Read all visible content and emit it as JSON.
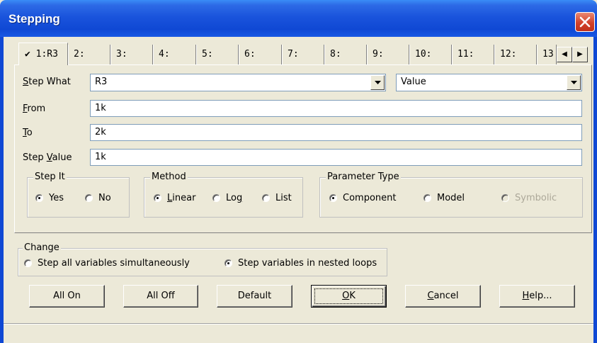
{
  "window": {
    "title": "Stepping"
  },
  "tabs": [
    {
      "label": "✔ 1:R3",
      "active": true
    },
    {
      "label": "2:"
    },
    {
      "label": "3:"
    },
    {
      "label": "4:"
    },
    {
      "label": "5:"
    },
    {
      "label": "6:"
    },
    {
      "label": "7:"
    },
    {
      "label": "8:"
    },
    {
      "label": "9:"
    },
    {
      "label": "10:"
    },
    {
      "label": "11:"
    },
    {
      "label": "12:"
    },
    {
      "label": "13"
    }
  ],
  "tab_scroll": {
    "left": "◀",
    "right": "▶"
  },
  "form": {
    "step_what": {
      "label_u": "S",
      "label_rest": "tep What",
      "value": "R3"
    },
    "step_what_attr": {
      "value": "Value"
    },
    "from": {
      "label_u": "F",
      "label_rest": "rom",
      "value": "1k"
    },
    "to": {
      "label_u": "T",
      "label_rest": "o",
      "value": "2k"
    },
    "step_value": {
      "label_pre": "Step ",
      "label_u": "V",
      "label_rest": "alue",
      "value": "1k"
    }
  },
  "step_it": {
    "title": "Step It",
    "options": [
      {
        "label": "Yes",
        "selected": true
      },
      {
        "label": "No",
        "selected": false
      }
    ]
  },
  "method": {
    "title": "Method",
    "linear": {
      "pre": "",
      "u": "L",
      "rest": "inear"
    },
    "log": {
      "pre": "Lo",
      "u": "g",
      "rest": ""
    },
    "list": "List",
    "selected": "Linear"
  },
  "parameter_type": {
    "title": "Parameter Type",
    "component": "Component",
    "model": "Model",
    "symbolic": "Symbolic",
    "selected": "Component"
  },
  "change": {
    "title": "Change",
    "all_simultaneous": "Step all variables simultaneously",
    "nested_loops": "Step variables in nested loops",
    "selected": "nested"
  },
  "buttons": {
    "all_on": "All On",
    "all_off": "All Off",
    "default": "Default",
    "ok_u": "O",
    "ok_rest": "K",
    "cancel_u": "C",
    "cancel_rest": "ancel",
    "help_u": "H",
    "help_rest": "elp..."
  },
  "colors": {
    "titlebar": "#0f48d4",
    "dialog": "#ece9d8",
    "close": "#d2412a"
  }
}
